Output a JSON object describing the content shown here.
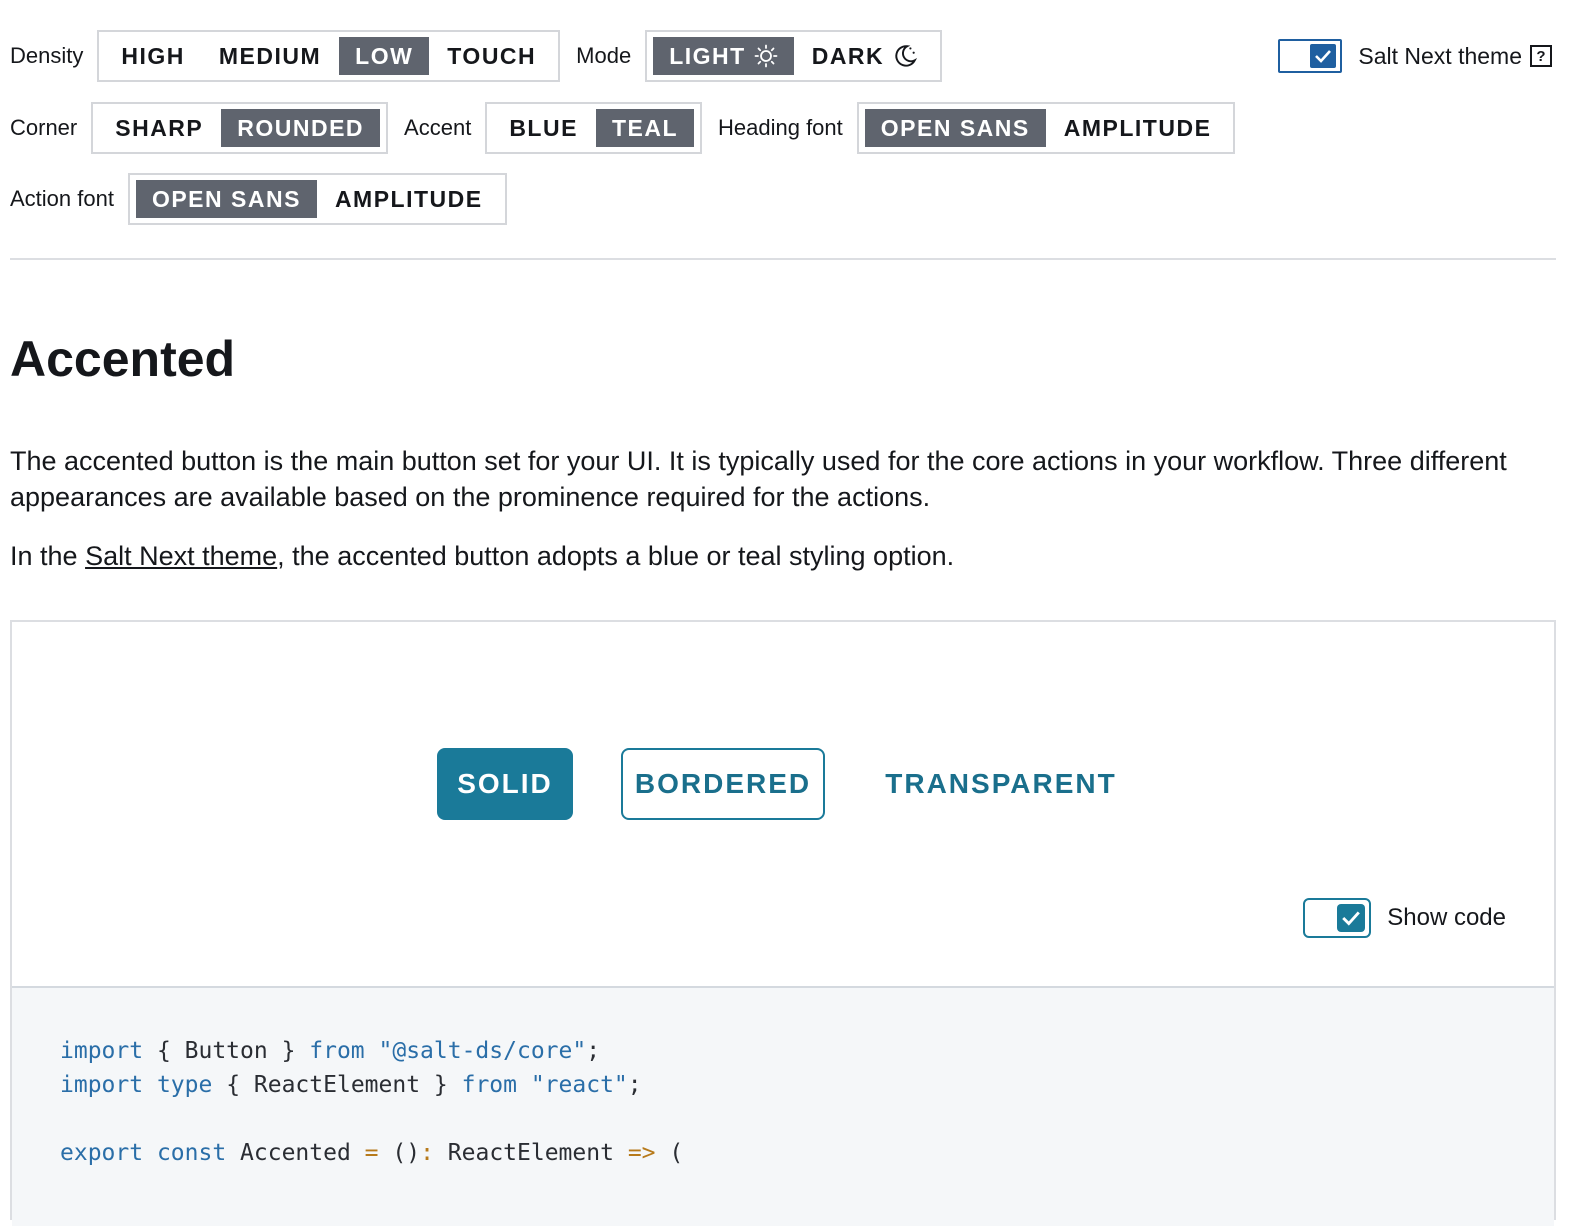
{
  "toolbar": {
    "density": {
      "label": "Density",
      "options": [
        "HIGH",
        "MEDIUM",
        "LOW",
        "TOUCH"
      ],
      "selected": "LOW"
    },
    "mode": {
      "label": "Mode",
      "options": [
        {
          "label": "LIGHT",
          "icon": "sun-icon"
        },
        {
          "label": "DARK",
          "icon": "moon-icon"
        }
      ],
      "selected": "LIGHT"
    },
    "corner": {
      "label": "Corner",
      "options": [
        "SHARP",
        "ROUNDED"
      ],
      "selected": "ROUNDED"
    },
    "accent": {
      "label": "Accent",
      "options": [
        "BLUE",
        "TEAL"
      ],
      "selected": "TEAL"
    },
    "heading_font": {
      "label": "Heading font",
      "options": [
        "OPEN SANS",
        "AMPLITUDE"
      ],
      "selected": "OPEN SANS"
    },
    "action_font": {
      "label": "Action font",
      "options": [
        "OPEN SANS",
        "AMPLITUDE"
      ],
      "selected": "OPEN SANS"
    },
    "salt_next_theme": {
      "label": "Salt Next theme",
      "checked": true,
      "help_label": "?"
    }
  },
  "page": {
    "title": "Accented",
    "paragraph1": "The accented button is the main button set for your UI. It is typically used for the core actions in your workflow. Three different appearances are available based on the prominence required for the actions.",
    "paragraph2_before": "In the ",
    "paragraph2_link": "Salt Next theme",
    "paragraph2_after": ", the accented button adopts a blue or teal styling option."
  },
  "example": {
    "buttons": [
      "SOLID",
      "BORDERED",
      "TRANSPARENT"
    ],
    "show_code": {
      "label": "Show code",
      "checked": true
    },
    "code": {
      "line1": {
        "kw1": "import",
        "mid": " { Button } ",
        "kw2": "from",
        "str": " \"@salt-ds/core\"",
        "end": ";"
      },
      "line2": {
        "kw1": "import",
        "kw1b": " type",
        "mid": " { ReactElement } ",
        "kw2": "from",
        "str": " \"react\"",
        "end": ";"
      },
      "line3": {
        "kw1": "export",
        "kw2": " const",
        "name": " Accented ",
        "op1": "=",
        "mid": " ()",
        "op2": ":",
        "type": " ReactElement ",
        "op3": "=>",
        "end": " ("
      }
    }
  },
  "colors": {
    "accent_teal": "#1a7a99",
    "selected_segment": "#5f646e",
    "theme_toggle_blue": "#1f5fa0"
  }
}
